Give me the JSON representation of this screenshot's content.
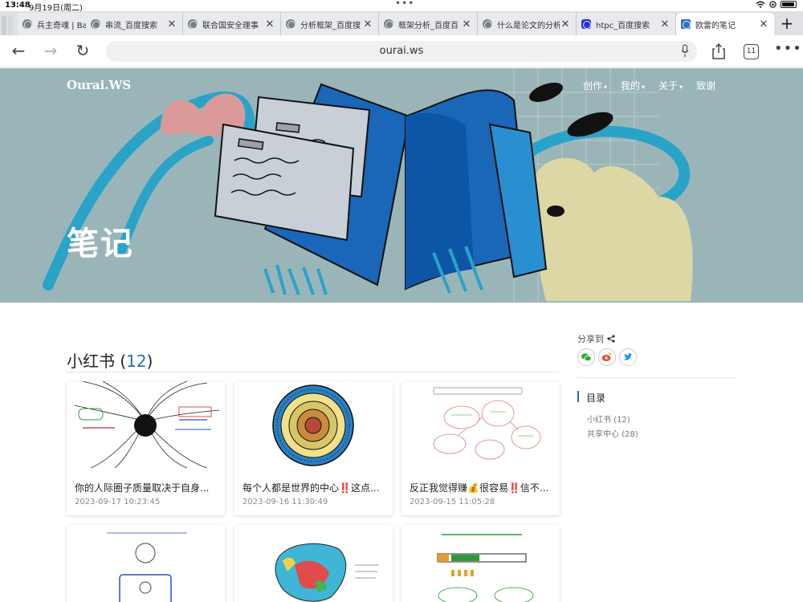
{
  "status": {
    "time": "13:48",
    "date": "9月19日(周二)"
  },
  "tabs": [
    {
      "label": "兵主奇魂 | Ba",
      "icon": "globe-icon"
    },
    {
      "label": "串流_百度搜索",
      "icon": "globe-icon"
    },
    {
      "label": "联合国安全理事",
      "icon": "globe-icon"
    },
    {
      "label": "分析框架_百度搜",
      "icon": "globe-icon"
    },
    {
      "label": "框架分析_百度百",
      "icon": "globe-icon"
    },
    {
      "label": "什么是论文的分析",
      "icon": "globe-icon"
    },
    {
      "label": "htpc_百度搜索",
      "icon": "baidu-icon"
    },
    {
      "label": "欧雷的笔记",
      "icon": "ourai-icon"
    }
  ],
  "toolbar": {
    "url": "ourai.ws",
    "tab_count": "11"
  },
  "site": {
    "logo": "Ourai.WS",
    "nav": [
      {
        "label": "创作",
        "caret": "▾"
      },
      {
        "label": "我的",
        "caret": "▾"
      },
      {
        "label": "关于",
        "caret": "▾"
      },
      {
        "label": "致谢",
        "caret": ""
      }
    ],
    "hero_title": "笔记"
  },
  "section": {
    "name": "小红书",
    "open": " (",
    "count": "12",
    "close": ")"
  },
  "cards": [
    {
      "title": "你的人际圈子质量取决于自身...",
      "date": "2023-09-17 10:23:45"
    },
    {
      "title": "每个人都是世界的中心‼️这点...",
      "date": "2023-09-16 11:30:49"
    },
    {
      "title": "反正我觉得赚💰很容易‼️信不...",
      "date": "2023-09-15 11:05:28"
    },
    {
      "title": "",
      "date": ""
    },
    {
      "title": "",
      "date": ""
    },
    {
      "title": "",
      "date": ""
    }
  ],
  "sidebar": {
    "share_label": "分享到",
    "share_buttons": [
      "wechat-icon",
      "weibo-icon",
      "twitter-icon"
    ],
    "toc_title": "目录",
    "toc_items": [
      "小红书 (12)",
      "共享中心 (28)"
    ]
  },
  "colors": {
    "accent": "#1d6fb5",
    "hero_bg": "#9ab5b8"
  }
}
